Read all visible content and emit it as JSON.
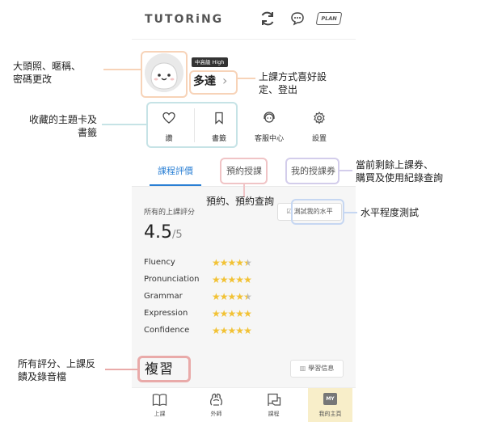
{
  "header": {
    "logo": "TUTORiNG",
    "plan_label": "PLAN"
  },
  "profile": {
    "level": "中高級 High",
    "name": "多達"
  },
  "shortcuts": [
    {
      "label": "讚"
    },
    {
      "label": "書籤"
    },
    {
      "label": "客服中心"
    },
    {
      "label": "設置"
    }
  ],
  "tabs": [
    {
      "label": "課程評價"
    },
    {
      "label": "預約授課"
    },
    {
      "label": "我的授課券"
    }
  ],
  "rating": {
    "label": "所有的上課評分",
    "score": "4.5",
    "denominator": "/5",
    "test_button": "測試我的水平",
    "skills": [
      {
        "name": "Fluency",
        "stars": 4.5
      },
      {
        "name": "Pronunciation",
        "stars": 5
      },
      {
        "name": "Grammar",
        "stars": 4.5
      },
      {
        "name": "Expression",
        "stars": 5
      },
      {
        "name": "Confidence",
        "stars": 5
      }
    ]
  },
  "review": {
    "title": "複習",
    "learning_info_button": "學習信息"
  },
  "bottom_nav": [
    {
      "label": "上課"
    },
    {
      "label": "外師"
    },
    {
      "label": "課程"
    },
    {
      "label": "我的主頁",
      "badge": "MY"
    }
  ],
  "annotations": {
    "avatar": "大頭照、暱稱、\n密碼更改",
    "method": "上課方式喜好設\n定、登出",
    "favorites": "收藏的主題卡及\n書籤",
    "vouchers": "當前剩餘上課券、\n購買及使用紀錄查詢",
    "booking": "預約、預約查詢",
    "level_test": "水平程度測試",
    "reviews": "所有評分、上課反\n饋及錄音檔"
  },
  "colors": {
    "accent": "#2a7fd4",
    "star": "#f2c235",
    "active_nav_bg": "#f8eec9"
  }
}
